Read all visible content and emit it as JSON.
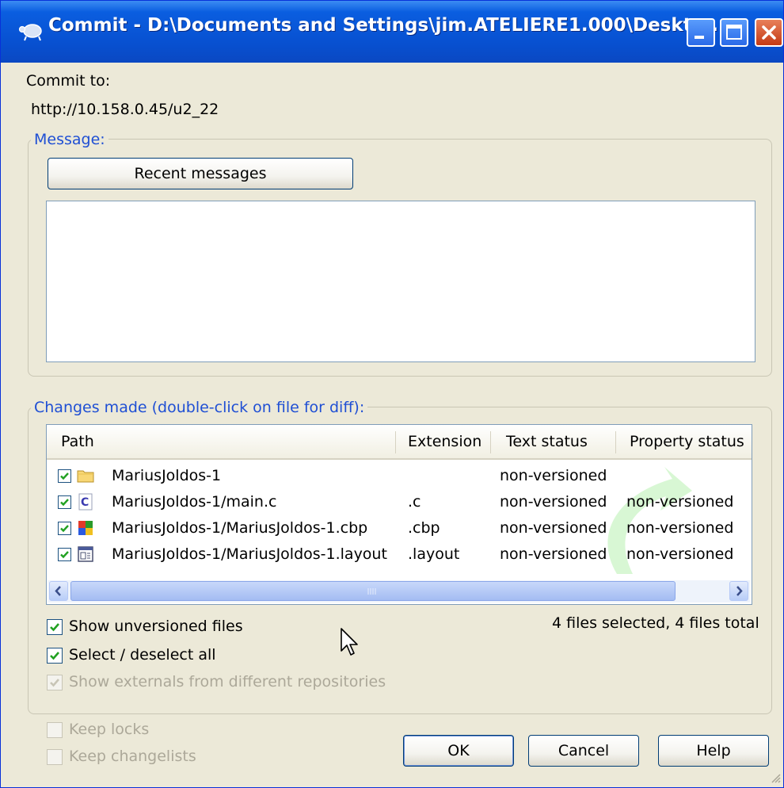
{
  "window": {
    "title": "Commit - D:\\Documents and Settings\\jim.ATELIERE1.000\\Deskto...",
    "controls": [
      "minimize-icon",
      "maximize-icon",
      "close-icon"
    ]
  },
  "commit_to": {
    "label": "Commit to:",
    "url": "http://10.158.0.45/u2_22"
  },
  "message": {
    "group_label": "Message:",
    "recent_button": "Recent messages",
    "text": ""
  },
  "changes": {
    "group_label": "Changes made (double-click on file for diff):",
    "columns": [
      "Path",
      "Extension",
      "Text status",
      "Property status"
    ],
    "rows": [
      {
        "checked": true,
        "icon": "folder-icon",
        "path": "MariusJoldos-1",
        "extension": "",
        "text_status": "non-versioned",
        "property_status": ""
      },
      {
        "checked": true,
        "icon": "c-source-file-icon",
        "path": "MariusJoldos-1/main.c",
        "extension": ".c",
        "text_status": "non-versioned",
        "property_status": "non-versioned"
      },
      {
        "checked": true,
        "icon": "codeblocks-project-icon",
        "path": "MariusJoldos-1/MariusJoldos-1.cbp",
        "extension": ".cbp",
        "text_status": "non-versioned",
        "property_status": "non-versioned"
      },
      {
        "checked": true,
        "icon": "layout-file-icon",
        "path": "MariusJoldos-1/MariusJoldos-1.layout",
        "extension": ".layout",
        "text_status": "non-versioned",
        "property_status": "non-versioned"
      }
    ],
    "summary": "4 files selected, 4 files total",
    "show_unversioned": {
      "label": "Show unversioned files",
      "checked": true
    },
    "select_all": {
      "label": "Select / deselect all",
      "checked": true
    },
    "show_externals": {
      "label": "Show externals from different repositories",
      "checked": true,
      "disabled": true
    }
  },
  "options": {
    "keep_locks": {
      "label": "Keep locks",
      "checked": false,
      "disabled": true
    },
    "keep_changelists": {
      "label": "Keep changelists",
      "checked": false,
      "disabled": true
    }
  },
  "buttons": {
    "ok": "OK",
    "cancel": "Cancel",
    "help": "Help"
  },
  "colors": {
    "titlebar": "#0a5ee0",
    "face": "#ece9d8",
    "group_label": "#1f4fd4",
    "check_green": "#21a121"
  }
}
